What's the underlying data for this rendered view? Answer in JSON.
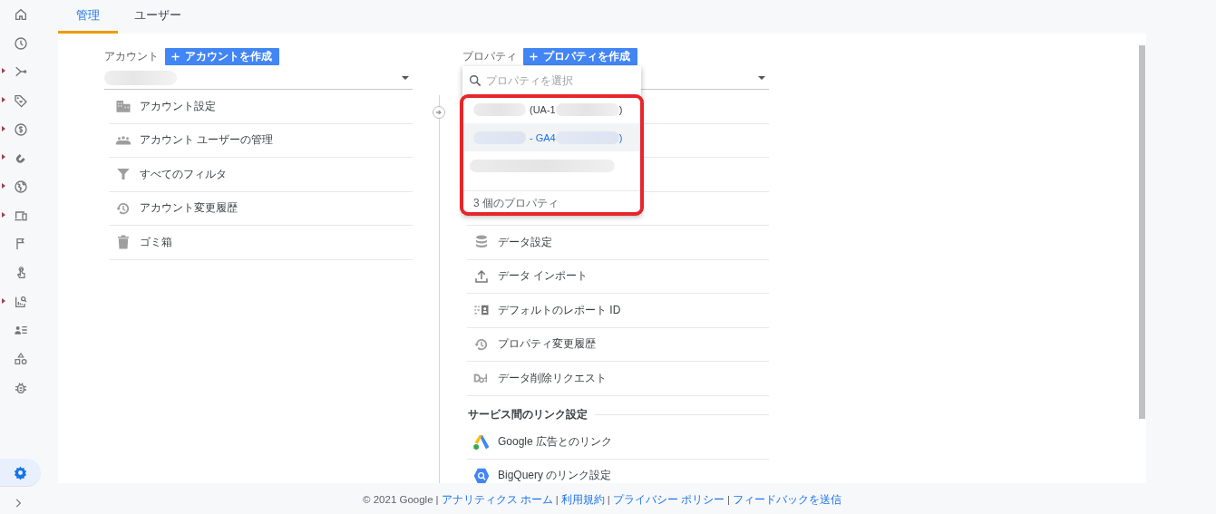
{
  "sidebar": {
    "items": [
      {
        "expandable": false,
        "selected": false
      },
      {
        "expandable": false,
        "selected": false
      },
      {
        "expandable": true,
        "selected": false
      },
      {
        "expandable": true,
        "selected": false
      },
      {
        "expandable": true,
        "selected": false
      },
      {
        "expandable": true,
        "selected": false
      },
      {
        "expandable": true,
        "selected": false
      },
      {
        "expandable": true,
        "selected": false
      },
      {
        "expandable": false,
        "selected": false
      },
      {
        "expandable": false,
        "selected": false
      },
      {
        "expandable": true,
        "selected": false
      },
      {
        "expandable": false,
        "selected": false
      },
      {
        "expandable": false,
        "selected": false
      },
      {
        "expandable": false,
        "selected": false
      }
    ],
    "settings": {
      "selected": true
    }
  },
  "tabs": [
    {
      "label": "管理",
      "selected": true
    },
    {
      "label": "ユーザー",
      "selected": false
    }
  ],
  "account": {
    "label": "アカウント",
    "create_button": "アカウントを作成",
    "menu": [
      "アカウント設定",
      "アカウント ユーザーの管理",
      "すべてのフィルタ",
      "アカウント変更履歴",
      "ゴミ箱"
    ]
  },
  "property": {
    "label": "プロパティ",
    "create_button": "プロパティを作成",
    "dropdown": {
      "placeholder": "プロパティを選択",
      "options": [
        {
          "text": "(UA-1",
          "suffix": ")",
          "selected": false
        },
        {
          "text": "- GA4",
          "suffix": ")",
          "selected": true
        },
        {
          "selected": false
        }
      ],
      "count": "3 個のプロパティ"
    },
    "menu": [
      "データ設定",
      "データ インポート",
      "デフォルトのレポート ID",
      "プロパティ変更履歴",
      "データ削除リクエスト"
    ],
    "section_title": "サービス間のリンク設定",
    "links": [
      "Google 広告とのリンク",
      "BigQuery のリンク設定"
    ]
  },
  "footer": [
    {
      "kind": "text",
      "text": "© 2021 Google"
    },
    {
      "kind": "sep",
      "text": "|"
    },
    {
      "kind": "link",
      "text": "アナリティクス ホーム"
    },
    {
      "kind": "sep",
      "text": "|"
    },
    {
      "kind": "link",
      "text": "利用規約"
    },
    {
      "kind": "sep",
      "text": "|"
    },
    {
      "kind": "link",
      "text": "プライバシー ポリシー"
    },
    {
      "kind": "sep",
      "text": "|"
    },
    {
      "kind": "link",
      "text": "フィードバックを送信"
    }
  ]
}
